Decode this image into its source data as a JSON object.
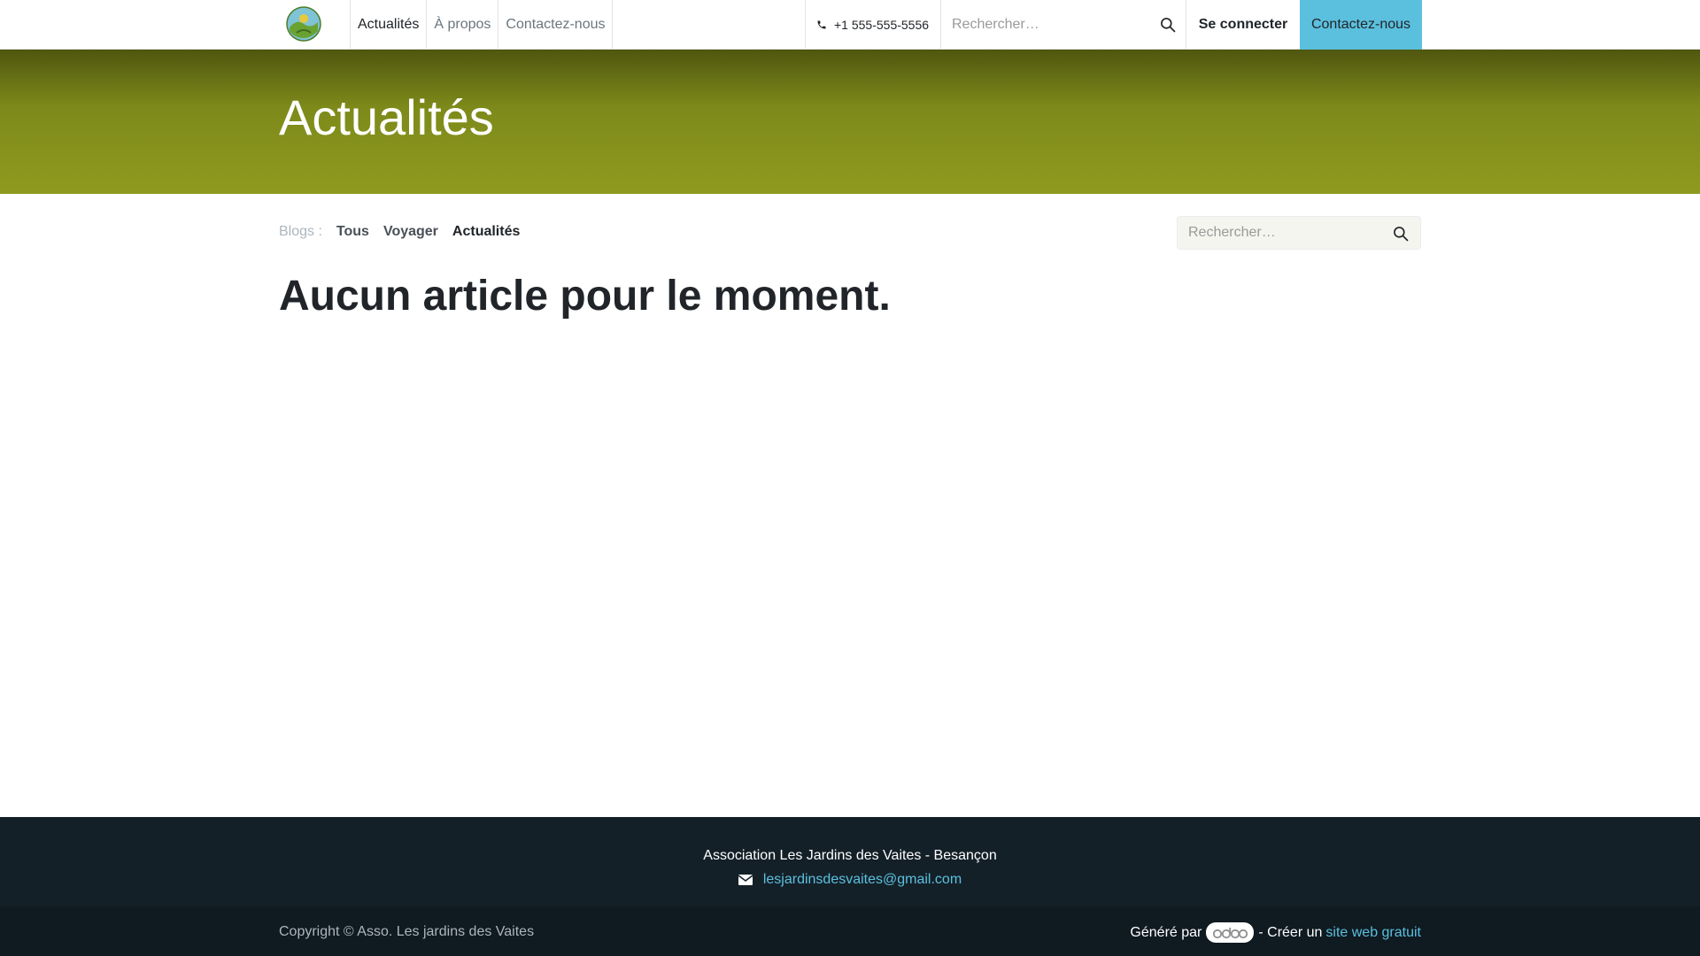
{
  "header": {
    "nav": [
      {
        "label": "Actualités",
        "active": true
      },
      {
        "label": "À propos",
        "active": false
      },
      {
        "label": "Contactez-nous",
        "active": false
      }
    ],
    "phone": "+1 555-555-5556",
    "search_placeholder": "Rechercher…",
    "signin_label": "Se connecter",
    "contact_label": "Contactez-nous"
  },
  "banner": {
    "title": "Actualités"
  },
  "blogs": {
    "label": "Blogs :",
    "tags": [
      {
        "label": "Tous",
        "active": false
      },
      {
        "label": "Voyager",
        "active": false
      },
      {
        "label": "Actualités",
        "active": true
      }
    ],
    "search_placeholder": "Rechercher…"
  },
  "main": {
    "empty_message": "Aucun article pour le moment."
  },
  "footer": {
    "org": "Association Les Jardins des Vaites - Besançon",
    "email": "lesjardinsdesvaites@gmail.com",
    "copyright": "Copyright © Asso. Les jardins des Vaites",
    "powered_prefix": "Généré par",
    "powered_middle": "- Créer un",
    "powered_link": "site web gratuit"
  },
  "colors": {
    "accent": "#5bc0de",
    "banner": "#8f9a1f",
    "footer": "#142028"
  },
  "icons": {
    "logo": "garden-logo-icon",
    "phone": "phone-icon",
    "search": "search-icon",
    "email": "envelope-icon",
    "brand": "odoo-logo-icon"
  }
}
